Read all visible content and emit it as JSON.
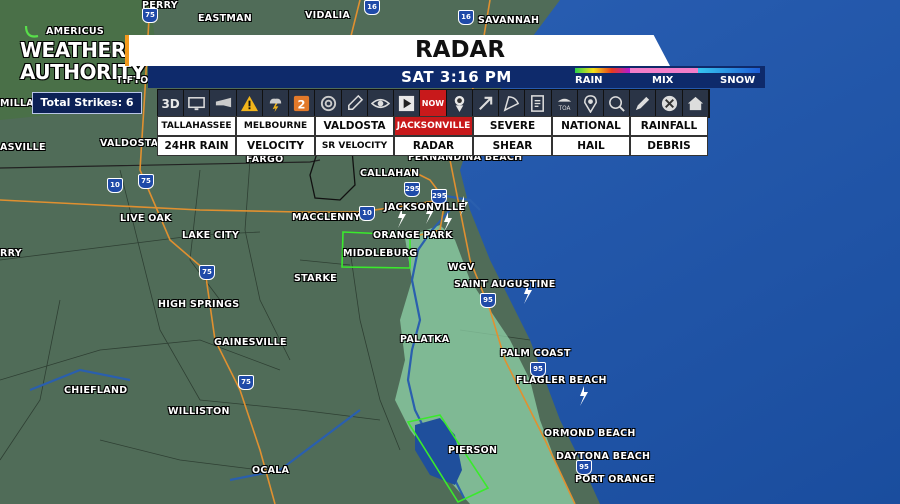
{
  "header": {
    "title": "RADAR",
    "time": "SAT 3:16 PM",
    "logo_line1": "WEATHER",
    "logo_line2": "AUTHORITY"
  },
  "legend": {
    "rain": "RAIN",
    "mix": "MIX",
    "snow": "SNOW",
    "colors": {
      "rain": [
        "#2bd14a",
        "#f4e21a",
        "#e83b1c",
        "#b11ad6"
      ],
      "mix": "#f27ec9",
      "snow": [
        "#36c6f0",
        "#1d5bd6"
      ]
    }
  },
  "strikes": {
    "label": "Total Strikes: 6"
  },
  "toolbar": {
    "icons": [
      "3d",
      "monitor-icon",
      "flashlight-icon",
      "warning-icon",
      "storm-icon",
      "weather-2-icon",
      "spiral-icon",
      "eyedropper-icon",
      "eye-icon",
      "play-icon",
      "now",
      "person-icon",
      "arrow-icon",
      "pizza-icon",
      "document-icon",
      "toa-icon",
      "pin-icon",
      "zoom-icon",
      "pencil-icon",
      "close-icon",
      "home-icon"
    ],
    "label_3d": "3D",
    "label_now": "NOW",
    "label_toa": "TOA"
  },
  "views": {
    "row1": [
      "TALLAHASSEE",
      "MELBOURNE",
      "VALDOSTA",
      "JACKSONVILLE",
      "SEVERE",
      "NATIONAL",
      "RAINFALL"
    ],
    "row2": [
      "24HR RAIN",
      "VELOCITY",
      "SR VELOCITY",
      "RADAR",
      "SHEAR",
      "HAIL",
      "DEBRIS"
    ],
    "active": "JACKSONVILLE"
  },
  "cities": {
    "americus": "AMERICUS",
    "eastman": "EASTMAN",
    "vidalia": "VIDALIA",
    "savannah": "SAVANNAH",
    "perry": "PERRY",
    "tifton": "TIFTON",
    "milla": "MILLA",
    "valdosta": "VALDOSTA",
    "asville": "ASVILLE",
    "fargo": "FARGO",
    "fernandina": "FERNANDINA BEACH",
    "callahan": "CALLAHAN",
    "jacksonville": "JACKSONVILLE",
    "macclenny": "MACCLENNY",
    "live_oak": "LIVE OAK",
    "lake_city": "LAKE CITY",
    "orange_park": "ORANGE PARK",
    "middleburg": "MIDDLEBURG",
    "rry": "RRY",
    "starke": "STARKE",
    "wgv": "WGV",
    "st_augustine": "SAINT AUGUSTINE",
    "high_springs": "HIGH SPRINGS",
    "palatka": "PALATKA",
    "gainesville": "GAINESVILLE",
    "palm_coast": "PALM COAST",
    "flagler": "FLAGLER BEACH",
    "chiefland": "CHIEFLAND",
    "williston": "WILLISTON",
    "ormond": "ORMOND BEACH",
    "pierson": "PIERSON",
    "daytona": "DAYTONA BEACH",
    "ocala": "OCALA",
    "port_orange": "PORT ORANGE"
  },
  "highways": {
    "i75": "75",
    "i16": "16",
    "i10": "10",
    "i295": "295",
    "i95": "95",
    "us16": "16"
  }
}
